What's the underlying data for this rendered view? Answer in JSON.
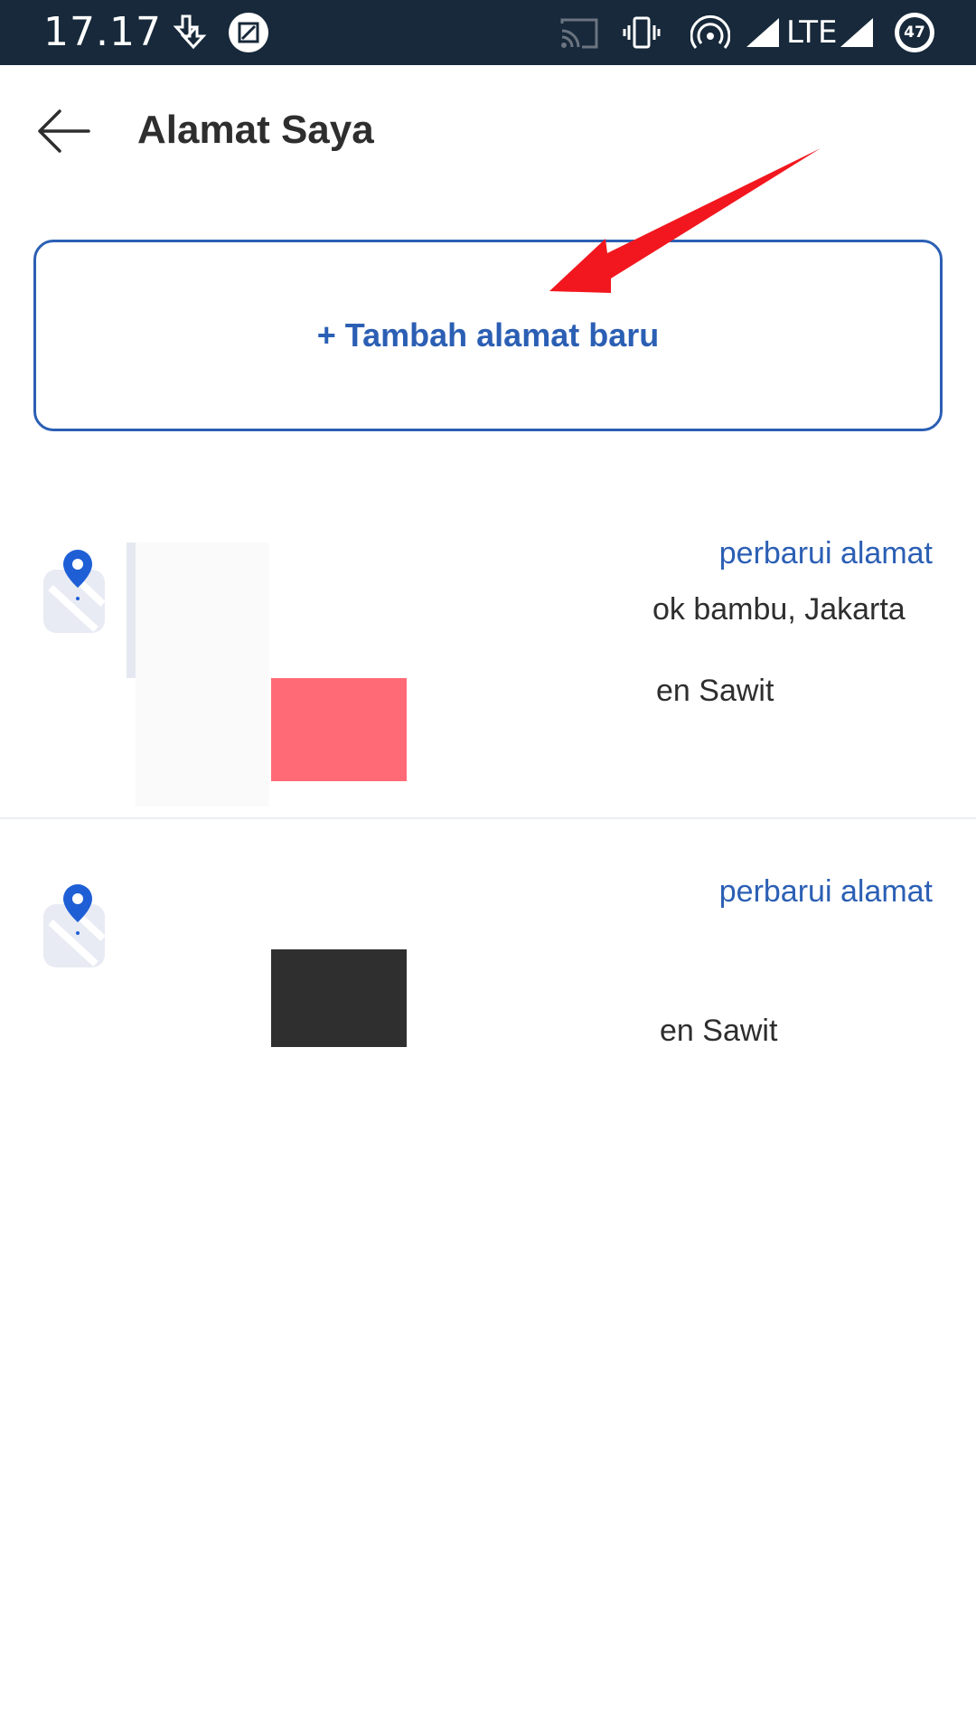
{
  "status_bar": {
    "time": "17.17",
    "network": "LTE",
    "battery": "47",
    "icons": [
      "download-icon",
      "screenshot-icon",
      "cast-icon",
      "vibrate-icon",
      "hotspot-icon",
      "signal-icon",
      "signal-icon",
      "battery-icon"
    ]
  },
  "header": {
    "title": "Alamat Saya",
    "back_icon": "back-arrow-icon"
  },
  "add_address": {
    "label": "+ Tambah alamat baru"
  },
  "addresses": [
    {
      "update_label": "perbarui alamat",
      "line_1": "ok bambu, Jakarta",
      "line_2": "en Sawit",
      "icon": "map-pin-icon"
    },
    {
      "update_label": "perbarui alamat",
      "line_2": "en Sawit",
      "icon": "map-pin-icon"
    }
  ],
  "colors": {
    "status_bar_bg": "#17293a",
    "accent": "#2b5fb4",
    "text": "#2e2e2e",
    "annotation_arrow": "#f2171e",
    "redaction_pink": "#ff6a76",
    "redaction_dark": "#2f2f2f"
  }
}
